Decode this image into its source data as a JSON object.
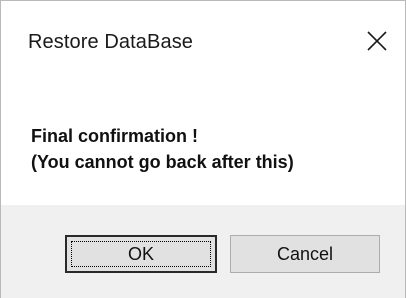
{
  "window": {
    "title": "Restore DataBase",
    "close_icon": "close-icon"
  },
  "message": {
    "line1": "Final confirmation !",
    "line2": "(You cannot go back after this)"
  },
  "buttons": {
    "ok_label": "OK",
    "cancel_label": "Cancel"
  },
  "colors": {
    "footer_background": "#f0f0f0",
    "button_background": "#e1e1e1",
    "button_border": "#adadad"
  }
}
